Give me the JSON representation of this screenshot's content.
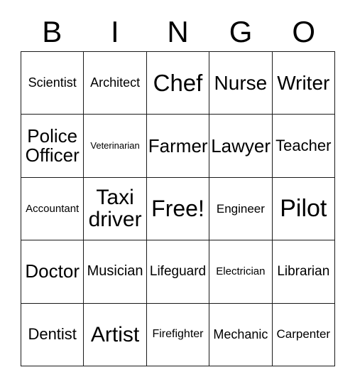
{
  "card": {
    "title_letters": [
      "B",
      "I",
      "N",
      "G",
      "O"
    ],
    "free_space_label": "Free!",
    "colors": {
      "background": "#ffffff",
      "grid_line": "#1a1a1a",
      "text": "#000000"
    },
    "rows": [
      [
        {
          "label": "Scientist",
          "size": "fs-18"
        },
        {
          "label": "Architect",
          "size": "fs-18"
        },
        {
          "label": "Chef",
          "size": "fs-33"
        },
        {
          "label": "Nurse",
          "size": "fs-28"
        },
        {
          "label": "Writer",
          "size": "fs-28"
        }
      ],
      [
        {
          "label": "Police\nOfficer",
          "size": "fs-26"
        },
        {
          "label": "Veterinarian",
          "size": "fs-13"
        },
        {
          "label": "Farmer",
          "size": "fs-26"
        },
        {
          "label": "Lawyer",
          "size": "fs-26"
        },
        {
          "label": "Teacher",
          "size": "fs-22"
        }
      ],
      [
        {
          "label": "Accountant",
          "size": "fs-15"
        },
        {
          "label": "Taxi\ndriver",
          "size": "fs-30"
        },
        {
          "label": "Free!",
          "size": "fs-32"
        },
        {
          "label": "Engineer",
          "size": "fs-17"
        },
        {
          "label": "Pilot",
          "size": "fs-34"
        }
      ],
      [
        {
          "label": "Doctor",
          "size": "fs-26"
        },
        {
          "label": "Musician",
          "size": "fs-20"
        },
        {
          "label": "Lifeguard",
          "size": "fs-19"
        },
        {
          "label": "Electrician",
          "size": "fs-15"
        },
        {
          "label": "Librarian",
          "size": "fs-19"
        }
      ],
      [
        {
          "label": "Dentist",
          "size": "fs-22"
        },
        {
          "label": "Artist",
          "size": "fs-30"
        },
        {
          "label": "Firefighter",
          "size": "fs-16"
        },
        {
          "label": "Mechanic",
          "size": "fs-18"
        },
        {
          "label": "Carpenter",
          "size": "fs-17"
        }
      ]
    ]
  }
}
